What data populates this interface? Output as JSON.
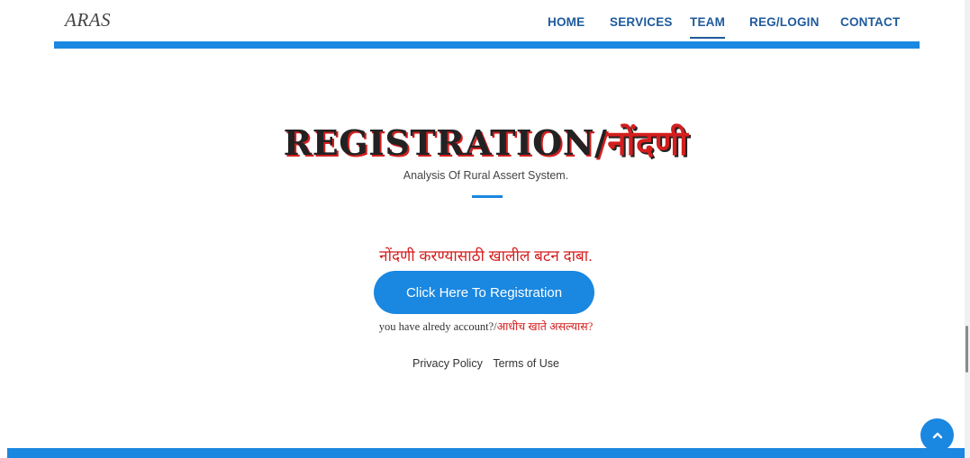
{
  "header": {
    "logo": "ARAS",
    "nav": [
      {
        "label": "HOME"
      },
      {
        "label": "SERVICES"
      },
      {
        "label": "TEAM"
      },
      {
        "label": "REG/LOGIN"
      },
      {
        "label": "CONTACT"
      }
    ],
    "active_nav": "TEAM"
  },
  "main": {
    "title_en": "REGISTRATION/",
    "title_mr": "नोंदणी",
    "subtitle": "Analysis Of Rural Assert System.",
    "prompt": "नोंदणी करण्यासाठी खालील बटन दाबा.",
    "register_button": "Click Here To Registration",
    "account_en": "you have alredy account?/",
    "account_mr": "आधीच खाते असल्यास?"
  },
  "footer": {
    "links": [
      "Privacy Policy",
      "Terms of Use"
    ]
  },
  "icons": {
    "back_to_top": "chevron-up-icon"
  },
  "colors": {
    "accent": "#1a87e0",
    "nav": "#1e5a9c",
    "marathi_red": "#d41e1e"
  }
}
